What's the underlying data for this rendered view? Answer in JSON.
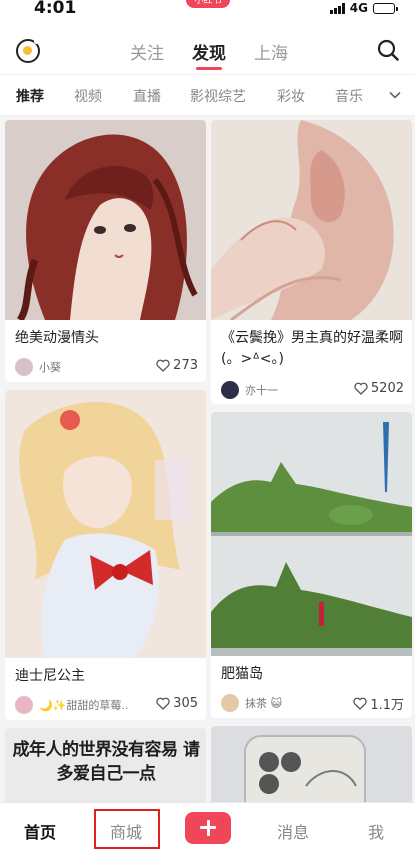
{
  "status_bar": {
    "time": "4:01",
    "notice": "小红书",
    "network": "4G"
  },
  "top_nav": {
    "tabs": [
      {
        "label": "关注",
        "active": false
      },
      {
        "label": "发现",
        "active": true
      },
      {
        "label": "上海",
        "active": false
      }
    ],
    "icons": [
      "logo-icon",
      "search-icon"
    ]
  },
  "categories": [
    "推荐",
    "视频",
    "直播",
    "影视综艺",
    "彩妆",
    "音乐"
  ],
  "feed": {
    "left": [
      {
        "title": "绝美动漫情头",
        "author": "小葵",
        "likes": "273",
        "image_tone": "#9e6a62"
      },
      {
        "title": "迪士尼公主",
        "author": "🌙✨甜甜的草莓...",
        "likes": "305",
        "image_tone": "#e2c9b6"
      },
      {
        "title": "成年人的世界没有容易 请多爱自己一点",
        "image_tone": "#e8e8e8"
      }
    ],
    "right": [
      {
        "title": "《云鬓挽》男主真的好温柔啊 (。>ᐞ<。)",
        "author": "亦十一",
        "likes": "5202",
        "image_tone": "#d7c9bd"
      },
      {
        "title": "肥猫岛",
        "author": "抹茶 😺",
        "likes": "1.1万",
        "image_tone": "#5f8f4a"
      },
      {
        "title": "",
        "image_tone": "#cfd3d8"
      }
    ]
  },
  "bottom_nav": {
    "items": [
      {
        "label": "首页",
        "active": true
      },
      {
        "label": "商城",
        "active": false,
        "highlighted": true
      },
      {
        "label": "消息",
        "active": false
      },
      {
        "label": "我",
        "active": false
      }
    ],
    "publish_icon": "plus-icon"
  },
  "colors": {
    "accent": "#f0465a",
    "highlight_box": "#e02020"
  }
}
